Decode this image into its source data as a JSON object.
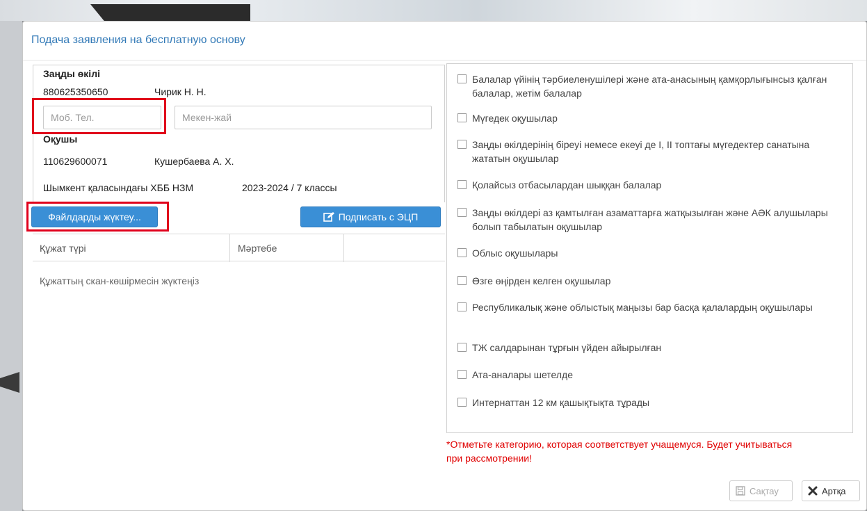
{
  "modal": {
    "title": "Подача заявления на бесплатную основу"
  },
  "representative": {
    "heading": "Заңды өкілі",
    "iin": "880625350650",
    "name": "Чирик Н. Н.",
    "phone_placeholder": "Моб. Тел.",
    "address_placeholder": "Мекен-жай"
  },
  "student": {
    "heading": "Оқушы",
    "iin": "110629600071",
    "name": "Кушербаева А. Х.",
    "school": "Шымкент қаласындағы ХББ НЗМ",
    "year_class": "2023-2024 / 7 классы"
  },
  "buttons": {
    "upload": "Файлдарды жүктеу...",
    "sign": "Подписать с ЭЦП",
    "save": "Сақтау",
    "back": "Артқа"
  },
  "doc_table": {
    "columns": [
      "Құжат түрі",
      "Мәртебе"
    ],
    "empty": "Құжаттың скан-көшірмесін жүктеңіз"
  },
  "categories": [
    "Балалар үйінің тәрбиеленушілері және ата-анасының қамқорлығынсыз қалған балалар, жетім балалар",
    "Мүгедек оқушылар",
    "Заңды өкілдерінің біреуі немесе екеуі де I, II топтағы мүгедектер санатына жататын оқушылар",
    "Қолайсыз отбасылардан шыққан балалар",
    "Заңды өкілдері аз қамтылған азаматтарға жатқызылған және АӘК алушылары болып табылатын оқушылар",
    "Облыс оқушылары",
    "Өзге өңірден келген оқушылар",
    "Республикалық және облыстық маңызы бар басқа қалалардың оқушылары",
    "ТЖ салдарынан тұрғын үйден айырылған",
    "Ата-аналары шетелде",
    "Интернаттан 12 км қашықтықта тұрады"
  ],
  "note": "*Отметьте категорию, которая соответствует учащемуся. Будет учитываться при рассмотрении!",
  "colors": {
    "accent": "#3a8fd6",
    "highlight": "#e0001b",
    "title": "#337ab7",
    "note": "#e00000"
  }
}
